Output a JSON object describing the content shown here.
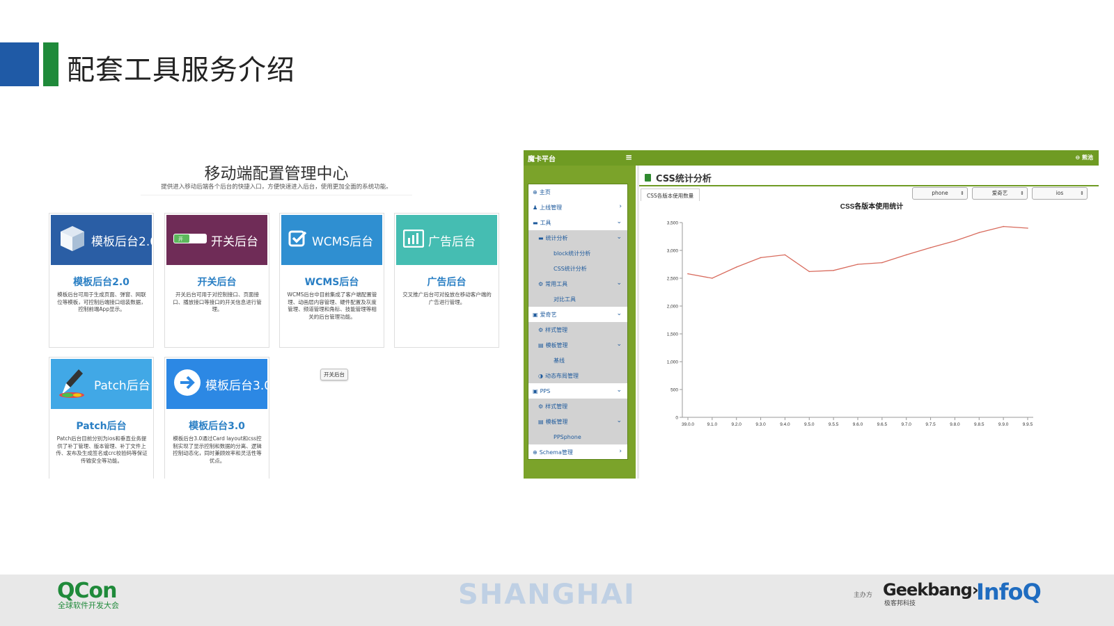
{
  "slide": {
    "title": "配套工具服务介绍"
  },
  "left": {
    "title": "移动端配置管理中心",
    "subtitle": "提供进入移动后端各个后台的快捷入口，方便快速进入后台，使用更加全面的系统功能。",
    "cards": [
      {
        "banner": "模板后台2.0",
        "title": "模板后台2.0",
        "desc": "模板后台可用于生成页面、弹窗、网联位等模板，可控制后端接口组装数据，控制前端App显示。",
        "color": "#2a5ea5",
        "icon": "box-icon"
      },
      {
        "banner": "开关后台",
        "title": "开关后台",
        "desc": "开关后台可用于对控制接口、页面接口、播放接口等接口的开关信息进行管理。",
        "color": "#6f2c57",
        "icon": "toggle-icon"
      },
      {
        "banner": "WCMS后台",
        "title": "WCMS后台",
        "desc": "WCMS后台中目前集成了客户端配置管理、动画层内容管理、硬件配置及灰度管理、频道管理和角标、技能管理等相关的后台管理功能。",
        "color": "#2f8fd1",
        "icon": "checkbox-icon"
      },
      {
        "banner": "广告后台",
        "title": "广告后台",
        "desc": "交叉推广后台可对投放在移动客户端的广告进行管理。",
        "color": "#45bdb2",
        "icon": "bar-chart-icon"
      },
      {
        "banner": "Patch后台",
        "title": "Patch后台",
        "desc": "Patch后台目前分别为ios和垂直业务提供了补丁管理、版本管理、补丁文件上传、发布及生成签名或crc校验码等保证传输安全等功能。",
        "color": "#41a8e6",
        "icon": "dropper-icon"
      },
      {
        "banner": "模板后台3.0",
        "title": "模板后台3.0",
        "desc": "模板后台3.0通过Card layout和css控制实现了显示控制和数据的分离、逻辑控制动态化，同时兼顾效率和灵活性等优点。",
        "color": "#2c88e4",
        "icon": "arrow-right-icon"
      }
    ],
    "tooltip": "开关后台"
  },
  "right": {
    "brand": "魔卡平台",
    "menu_icon": "≡",
    "user": "⊖ 熊池",
    "nav": [
      {
        "label": "主页",
        "icon": "⊕",
        "chevron": "",
        "level": 0,
        "gray": false
      },
      {
        "label": "上线管理",
        "icon": "♟",
        "chevron": "›",
        "level": 0,
        "gray": false
      },
      {
        "label": "工具",
        "icon": "▬",
        "chevron": "⌄",
        "level": 0,
        "gray": false
      },
      {
        "label": "统计分析",
        "icon": "▬",
        "chevron": "⌄",
        "level": 1,
        "gray": true
      },
      {
        "label": "block统计分析",
        "icon": "",
        "chevron": "",
        "level": 2,
        "gray": true
      },
      {
        "label": "CSS统计分析",
        "icon": "",
        "chevron": "",
        "level": 2,
        "gray": true
      },
      {
        "label": "常用工具",
        "icon": "⚙",
        "chevron": "⌄",
        "level": 1,
        "gray": true
      },
      {
        "label": "对比工具",
        "icon": "",
        "chevron": "",
        "level": 2,
        "gray": true
      },
      {
        "label": "爱奇艺",
        "icon": "▣",
        "chevron": "⌄",
        "level": 0,
        "gray": false
      },
      {
        "label": "样式管理",
        "icon": "⚙",
        "chevron": "",
        "level": 1,
        "gray": true
      },
      {
        "label": "模板管理",
        "icon": "▤",
        "chevron": "⌄",
        "level": 1,
        "gray": true
      },
      {
        "label": "基线",
        "icon": "",
        "chevron": "",
        "level": 2,
        "gray": true
      },
      {
        "label": "动态布局管理",
        "icon": "◑",
        "chevron": "",
        "level": 1,
        "gray": true
      },
      {
        "label": "PPS",
        "icon": "▣",
        "chevron": "⌄",
        "level": 0,
        "gray": false
      },
      {
        "label": "样式管理",
        "icon": "⚙",
        "chevron": "",
        "level": 1,
        "gray": true
      },
      {
        "label": "模板管理",
        "icon": "▤",
        "chevron": "⌄",
        "level": 1,
        "gray": true
      },
      {
        "label": "PPSphone",
        "icon": "",
        "chevron": "",
        "level": 2,
        "gray": true
      },
      {
        "label": "Schema管理",
        "icon": "⊕",
        "chevron": "›",
        "level": 0,
        "gray": false
      }
    ],
    "page_title": "CSS统计分析",
    "tab": "CSS各版本使用数量",
    "selects": [
      "phone",
      "爱奇艺",
      "ios"
    ]
  },
  "chart_data": {
    "type": "line",
    "title": "CSS各版本使用统计",
    "categories": [
      "39.0.0",
      "9.1.0",
      "9.2.0",
      "9.3.0",
      "9.4.0",
      "9.5.0",
      "9.5.5",
      "9.6.0",
      "9.6.5",
      "9.7.0",
      "9.7.5",
      "9.8.0",
      "9.8.5",
      "9.9.0",
      "9.9.5"
    ],
    "series": [
      {
        "values": [
          2580,
          2500,
          2700,
          2870,
          2920,
          2620,
          2640,
          2750,
          2780,
          2920,
          3050,
          3170,
          3320,
          3430,
          3400
        ]
      }
    ],
    "yticks": [
      "0",
      "500",
      "1,000",
      "1,500",
      "2,000",
      "2,500",
      "3,000",
      "3,500"
    ],
    "ylim": [
      0,
      3500
    ],
    "line_color": "#d86a5c"
  },
  "footer": {
    "qcon": "QCon",
    "qcon_sub": "全球软件开发大会",
    "city": "SHANGHAI",
    "host": "主办方",
    "geek": "Geekbang›",
    "geek_sub": "极客邦科技",
    "infoq": "InfoQ"
  }
}
